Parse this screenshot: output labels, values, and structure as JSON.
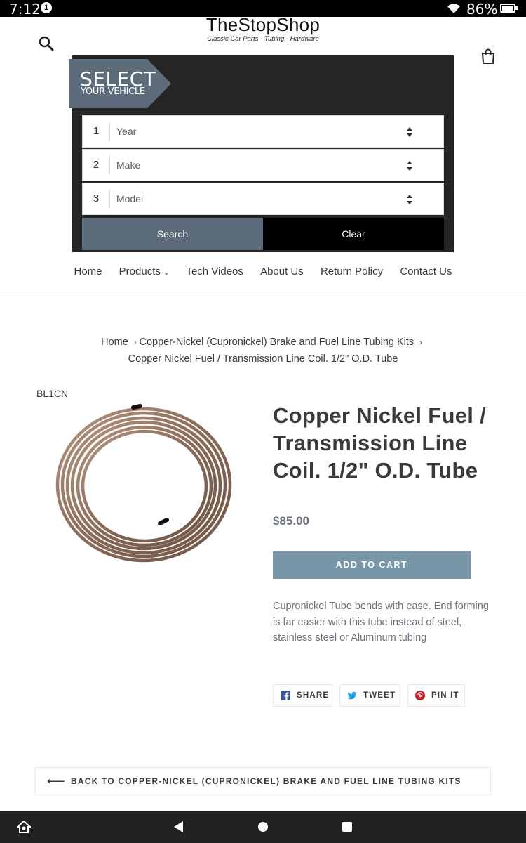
{
  "status_bar": {
    "time": "7:12",
    "notification": "1",
    "battery": "86%"
  },
  "header": {
    "store_name": "TheStopShop",
    "tagline": "Classic Car Parts - Tubing - Hardware",
    "search_icon": "search-icon",
    "cart_icon": "shopping-bag-icon"
  },
  "vehicle_selector": {
    "banner_line1": "SELECT",
    "banner_line2": "YOUR VEHICLE",
    "rows": [
      {
        "num": "1",
        "label": "Year"
      },
      {
        "num": "2",
        "label": "Make"
      },
      {
        "num": "3",
        "label": "Model"
      }
    ],
    "search_label": "Search",
    "clear_label": "Clear"
  },
  "nav": {
    "items": [
      "Home",
      "Products",
      "Tech Videos",
      "About Us",
      "Return Policy",
      "Contact Us"
    ]
  },
  "breadcrumb": {
    "home": "Home",
    "sep": "›",
    "collection": "Copper-Nickel (Cupronickel) Brake and Fuel Line Tubing Kits",
    "current": "Copper Nickel Fuel / Transmission Line Coil. 1/2\" O.D. Tube"
  },
  "product": {
    "sku": "BL1CN",
    "title": "Copper Nickel Fuel / Transmission Line Coil. 1/2\" O.D. Tube",
    "price": "$85.00",
    "add_to_cart": "ADD TO CART",
    "description": "Cupronickel Tube bends with ease. End forming is far easier with this tube instead of steel, stainless steel or Aluminum tubing"
  },
  "share": {
    "facebook": "SHARE",
    "twitter": "TWEET",
    "pinterest": "PIN IT"
  },
  "back_link": {
    "arrow": "⟵",
    "label": "BACK TO COPPER-NICKEL (CUPRONICKEL) BRAKE AND FUEL LINE TUBING KITS"
  },
  "colors": {
    "add_to_cart": "#7796a8",
    "search_button": "#5c6c7b",
    "selector_bg": "#252525",
    "price": "#69727b"
  }
}
